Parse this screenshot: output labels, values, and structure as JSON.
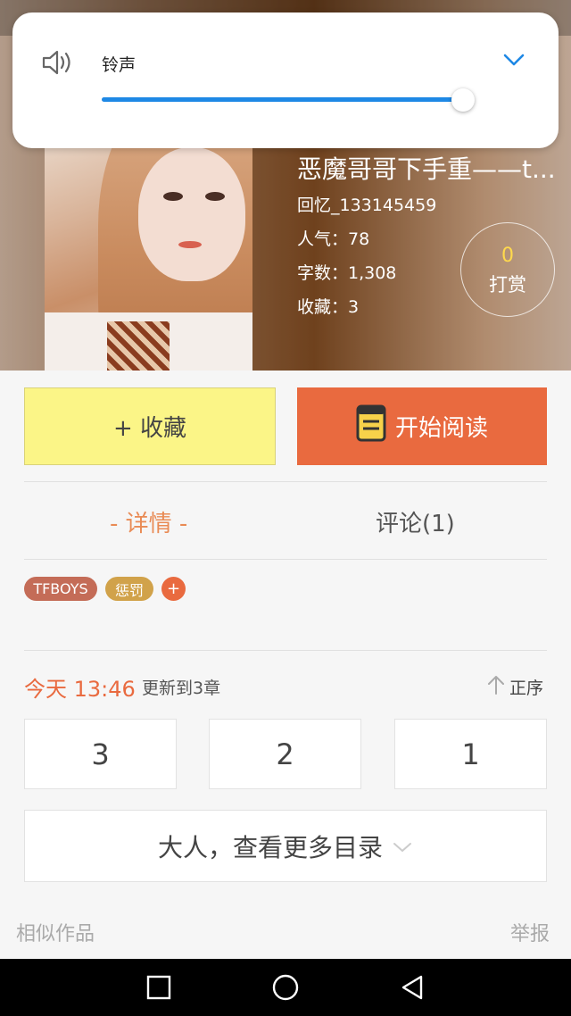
{
  "volume_popup": {
    "label": "铃声",
    "level_fraction": 0.97
  },
  "book": {
    "title": "恶魔哥哥下手重——t...",
    "author": "回忆_133145459",
    "popularity": "人气：78",
    "word_count": "字数：1,308",
    "favorites": "收藏：3",
    "reward_count": "0",
    "reward_label": "打赏"
  },
  "actions": {
    "favorite_label": "+ 收藏",
    "read_label": "开始阅读"
  },
  "tabs": {
    "detail": "- 详情 -",
    "comments": "评论(1)"
  },
  "tags": [
    {
      "label": "TFBOYS",
      "color": "#c46c57"
    },
    {
      "label": "惩罚",
      "color": "#d1a24a"
    }
  ],
  "add_tag_label": "+",
  "updates": {
    "time": "今天 13:46",
    "text": "更新到3章",
    "sort_label": "正序"
  },
  "chapters": [
    "3",
    "2",
    "1"
  ],
  "more_catalog_label": "大人，查看更多目录",
  "footer": {
    "similar_works": "相似作品",
    "report": "举报"
  },
  "colors": {
    "accent": "#e96a3f",
    "favorite_button": "#fbf587",
    "slider": "#1e88e5"
  },
  "icons": [
    "speaker-icon",
    "chevron-down-icon",
    "book-icon",
    "arrow-up-icon",
    "recent-apps-icon",
    "home-icon",
    "back-icon"
  ]
}
